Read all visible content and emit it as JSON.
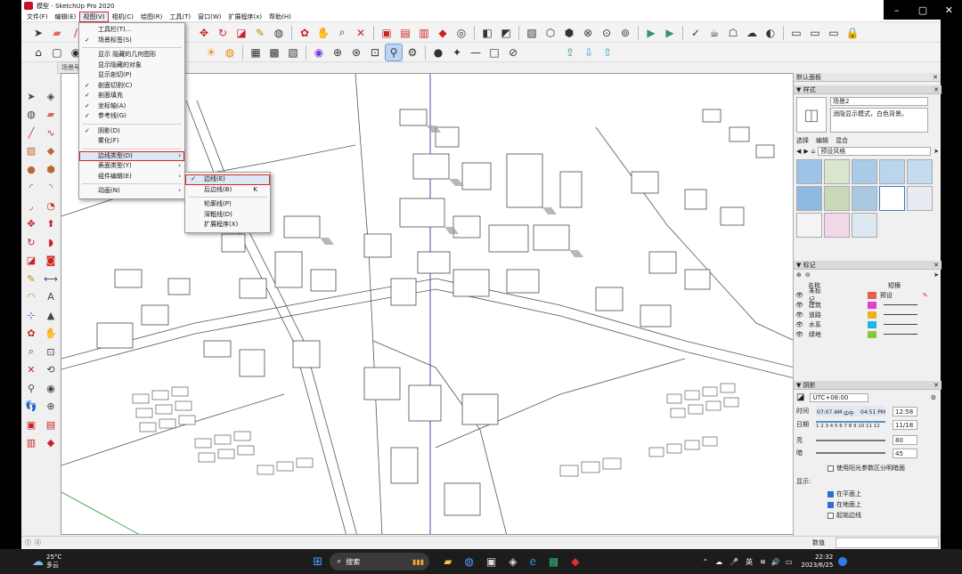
{
  "window": {
    "title": "模型 - SketchUp Pro 2020",
    "minimize": "–",
    "maximize": "▢",
    "close": "✕"
  },
  "menubar": [
    "文件(F)",
    "编辑(E)",
    "视图(V)",
    "相机(C)",
    "绘图(R)",
    "工具(T)",
    "窗口(W)",
    "扩展程序(x)",
    "帮助(H)"
  ],
  "scenes_tab": "场景号",
  "view_menu": [
    {
      "label": "工具栏(T)...",
      "check": false
    },
    {
      "label": "场景标签(S)",
      "check": true
    },
    {
      "sep": true
    },
    {
      "label": "显示 隐藏的几何图形",
      "check": false
    },
    {
      "label": "显示隐藏的对象",
      "check": false
    },
    {
      "label": "显示剖切(P)",
      "check": false
    },
    {
      "label": "剖面切割(C)",
      "check": true
    },
    {
      "label": "剖面填充",
      "check": true
    },
    {
      "label": "坐标轴(A)",
      "check": true
    },
    {
      "label": "参考线(G)",
      "check": true
    },
    {
      "sep": true
    },
    {
      "label": "阴影(D)",
      "check": true
    },
    {
      "label": "雾化(F)",
      "check": false
    },
    {
      "sep": true
    },
    {
      "label": "边线类型(D)",
      "check": false,
      "sub": true,
      "boxed": true
    },
    {
      "label": "表面类型(Y)",
      "check": false,
      "sub": true
    },
    {
      "label": "组件编辑(E)",
      "check": false,
      "sub": true
    },
    {
      "sep": true
    },
    {
      "label": "动画(N)",
      "check": false,
      "sub": true
    }
  ],
  "edge_submenu": [
    {
      "label": "边线(E)",
      "check": true,
      "boxed": true
    },
    {
      "label": "后边线(B)",
      "shortcut": "K"
    },
    {
      "sep": true
    },
    {
      "label": "轮廓线(P)"
    },
    {
      "label": "深粗线(D)"
    },
    {
      "label": "扩展程序(X)"
    }
  ],
  "panel": {
    "title": "默认面板",
    "styles": {
      "header": "样式",
      "name": "场景2",
      "desc": "消隐显示模式，白色背景。",
      "tabs": [
        "选择",
        "编辑",
        "混合"
      ],
      "collection": "预设风格"
    },
    "tags": {
      "header": "标记",
      "col_name": "名称",
      "col_dash": "短横",
      "rows": [
        {
          "name": "未标记",
          "color": "#e8604c",
          "dash": "预设"
        },
        {
          "name": "建筑",
          "color": "#e83bd6",
          "dash": ""
        },
        {
          "name": "道路",
          "color": "#f2b01e",
          "dash": ""
        },
        {
          "name": "水系",
          "color": "#1fb5e8",
          "dash": ""
        },
        {
          "name": "绿地",
          "color": "#8cc63e",
          "dash": ""
        }
      ]
    },
    "shadows": {
      "header": "阴影",
      "timezone": "UTC+08:00",
      "time_label": "时间",
      "time_start": "07:07 AM",
      "time_mid": "中午",
      "time_end": "04:51 PM",
      "time_value": "12:58",
      "date_label": "日期",
      "months": "1 2 3 4 5 6 7 8 9 10 11 12",
      "date_value": "11/18",
      "light_label": "亮",
      "light_value": "80",
      "dark_label": "暗",
      "dark_value": "45",
      "sun_shading": "使用阳光参数区分明暗面",
      "display_label": "显示:",
      "on_faces": "在平面上",
      "on_ground": "在地面上",
      "from_edges": "起始边线"
    }
  },
  "statusbar": {
    "measure_label": "数值"
  },
  "taskbar": {
    "temp": "25°C",
    "weather": "多云",
    "search": "搜索",
    "ime": "英",
    "time": "22:32",
    "date": "2023/6/25"
  }
}
